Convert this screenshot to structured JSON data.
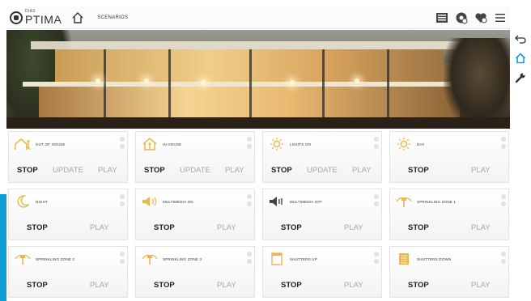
{
  "header": {
    "logo_small": "DIAS",
    "logo_text": "PTIMA",
    "breadcrumb": "SCENARIOS"
  },
  "icons": {
    "logo": "logo-mark",
    "home": "home-icon",
    "top_right": [
      "list-panel-icon",
      "settings-cog-icon",
      "heart-cog-icon",
      "menu-icon"
    ],
    "sidebar": [
      "back-arrow-icon",
      "home-icon",
      "wrench-icon"
    ]
  },
  "colors": {
    "accent": "#0e9fd8",
    "icon_gold": "#e8b84a",
    "stop_text": "#222222",
    "muted_text": "#a9a9a9"
  },
  "scenarios": [
    {
      "label": "OUT OF HOUSE",
      "icon": "leaving-house-icon",
      "stop": "STOP",
      "update": "UPDATE",
      "play": "PLAY"
    },
    {
      "label": "IN HOUSE",
      "icon": "house-person-icon",
      "stop": "STOP",
      "update": "UPDATE",
      "play": "PLAY"
    },
    {
      "label": "LIGHTS ON",
      "icon": "sun-icon",
      "stop": "STOP",
      "update": "UPDATE",
      "play": "PLAY"
    },
    {
      "label": "DAY",
      "icon": "sun-icon",
      "stop": "STOP",
      "play": "PLAY"
    },
    {
      "label": "NIGHT",
      "icon": "moon-icon",
      "stop": "STOP",
      "play": "PLAY"
    },
    {
      "label": "MULTIMEDIA ON",
      "icon": "speaker-on-icon",
      "stop": "STOP",
      "play": "PLAY"
    },
    {
      "label": "MULTIMEDIA OFF",
      "icon": "speaker-off-icon",
      "stop": "STOP",
      "play": "PLAY"
    },
    {
      "label": "SPRINKLING ZONE 1",
      "icon": "sprinkler-icon",
      "stop": "STOP",
      "play": "PLAY"
    },
    {
      "label": "SPRINKLING ZONE 2",
      "icon": "sprinkler-icon",
      "stop": "STOP",
      "play": "PLAY"
    },
    {
      "label": "SPRINKLING ZONE 3",
      "icon": "sprinkler-icon",
      "stop": "STOP",
      "play": "PLAY"
    },
    {
      "label": "SHUTTERS UP",
      "icon": "shutter-up-icon",
      "stop": "STOP",
      "play": "PLAY"
    },
    {
      "label": "SHUTTERS DOWN",
      "icon": "shutter-down-icon",
      "stop": "STOP",
      "play": "PLAY"
    }
  ]
}
